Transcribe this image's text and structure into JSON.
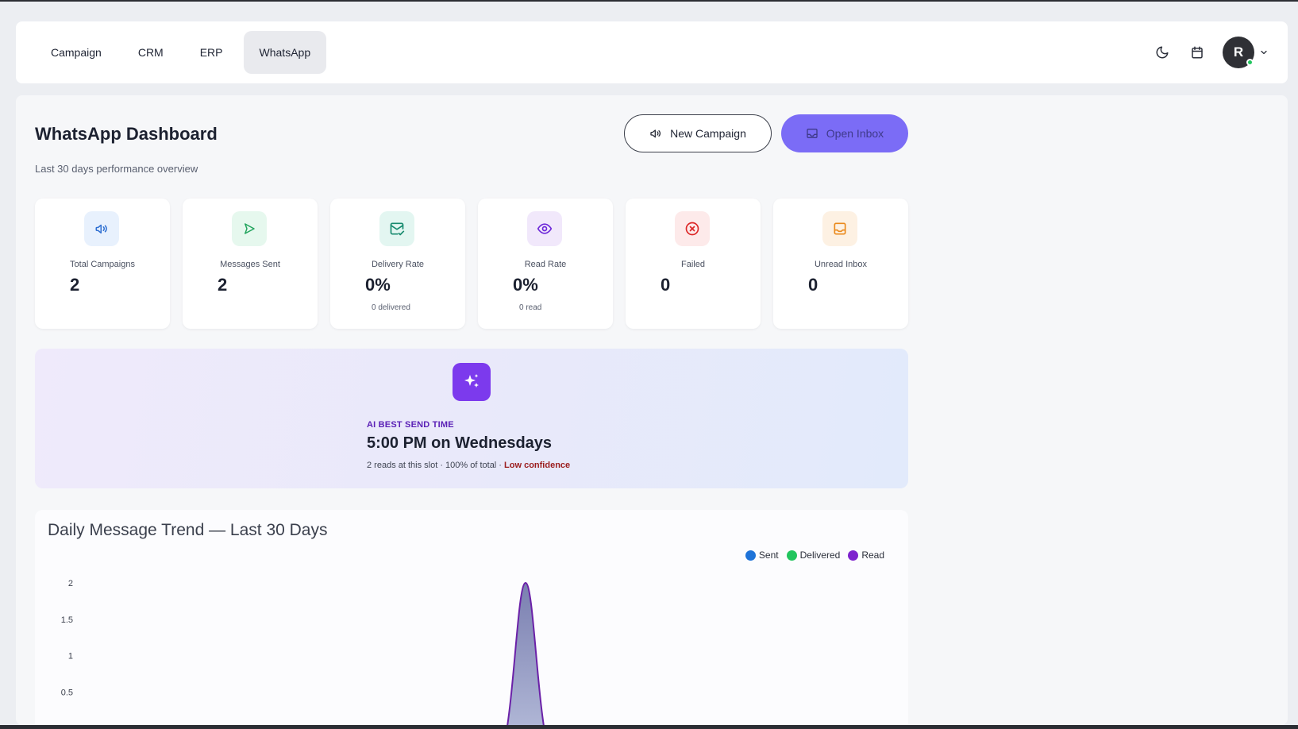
{
  "nav": {
    "tabs": [
      {
        "label": "Campaign"
      },
      {
        "label": "CRM"
      },
      {
        "label": "ERP"
      },
      {
        "label": "WhatsApp"
      }
    ],
    "active_tab": "WhatsApp",
    "avatar_initial": "R"
  },
  "header": {
    "title": "WhatsApp Dashboard",
    "subtitle": "Last 30 days performance overview",
    "new_campaign_label": "New Campaign",
    "open_inbox_label": "Open Inbox"
  },
  "stats": [
    {
      "label": "Total Campaigns",
      "value": "2",
      "sub": "",
      "icon": "megaphone-icon",
      "icon_bg": "#e8f1fd",
      "icon_color": "#2f6fd1"
    },
    {
      "label": "Messages Sent",
      "value": "2",
      "sub": "",
      "icon": "send-icon",
      "icon_bg": "#e6f8ee",
      "icon_color": "#22a45d"
    },
    {
      "label": "Delivery Rate",
      "value": "0%",
      "sub": "0 delivered",
      "icon": "mail-check-icon",
      "icon_bg": "#e3f6f1",
      "icon_color": "#178a6e"
    },
    {
      "label": "Read Rate",
      "value": "0%",
      "sub": "0 read",
      "icon": "eye-icon",
      "icon_bg": "#f1e8fb",
      "icon_color": "#6d28d9"
    },
    {
      "label": "Failed",
      "value": "0",
      "sub": "",
      "icon": "x-circle-icon",
      "icon_bg": "#fdeaea",
      "icon_color": "#dc2626"
    },
    {
      "label": "Unread Inbox",
      "value": "0",
      "sub": "",
      "icon": "inbox-icon",
      "icon_bg": "#fdf1e3",
      "icon_color": "#ea8a1c"
    }
  ],
  "ai": {
    "kicker": "AI BEST SEND TIME",
    "title": "5:00 PM on Wednesdays",
    "detail": "2 reads at this slot · 100% of total · ",
    "confidence": "Low confidence"
  },
  "chart_data": {
    "type": "area",
    "title": "Daily Message Trend — Last 30 Days",
    "legend_position": "top-right",
    "yticks": [
      "2",
      "1.5",
      "1",
      "0.5"
    ],
    "ylim": [
      0,
      2
    ],
    "grid": false,
    "series": [
      {
        "name": "Sent",
        "color": "#1e73d8"
      },
      {
        "name": "Delivered",
        "color": "#22c55e"
      },
      {
        "name": "Read",
        "color": "#7e22ce"
      }
    ],
    "peak": {
      "value": 2,
      "position": "middle"
    }
  }
}
